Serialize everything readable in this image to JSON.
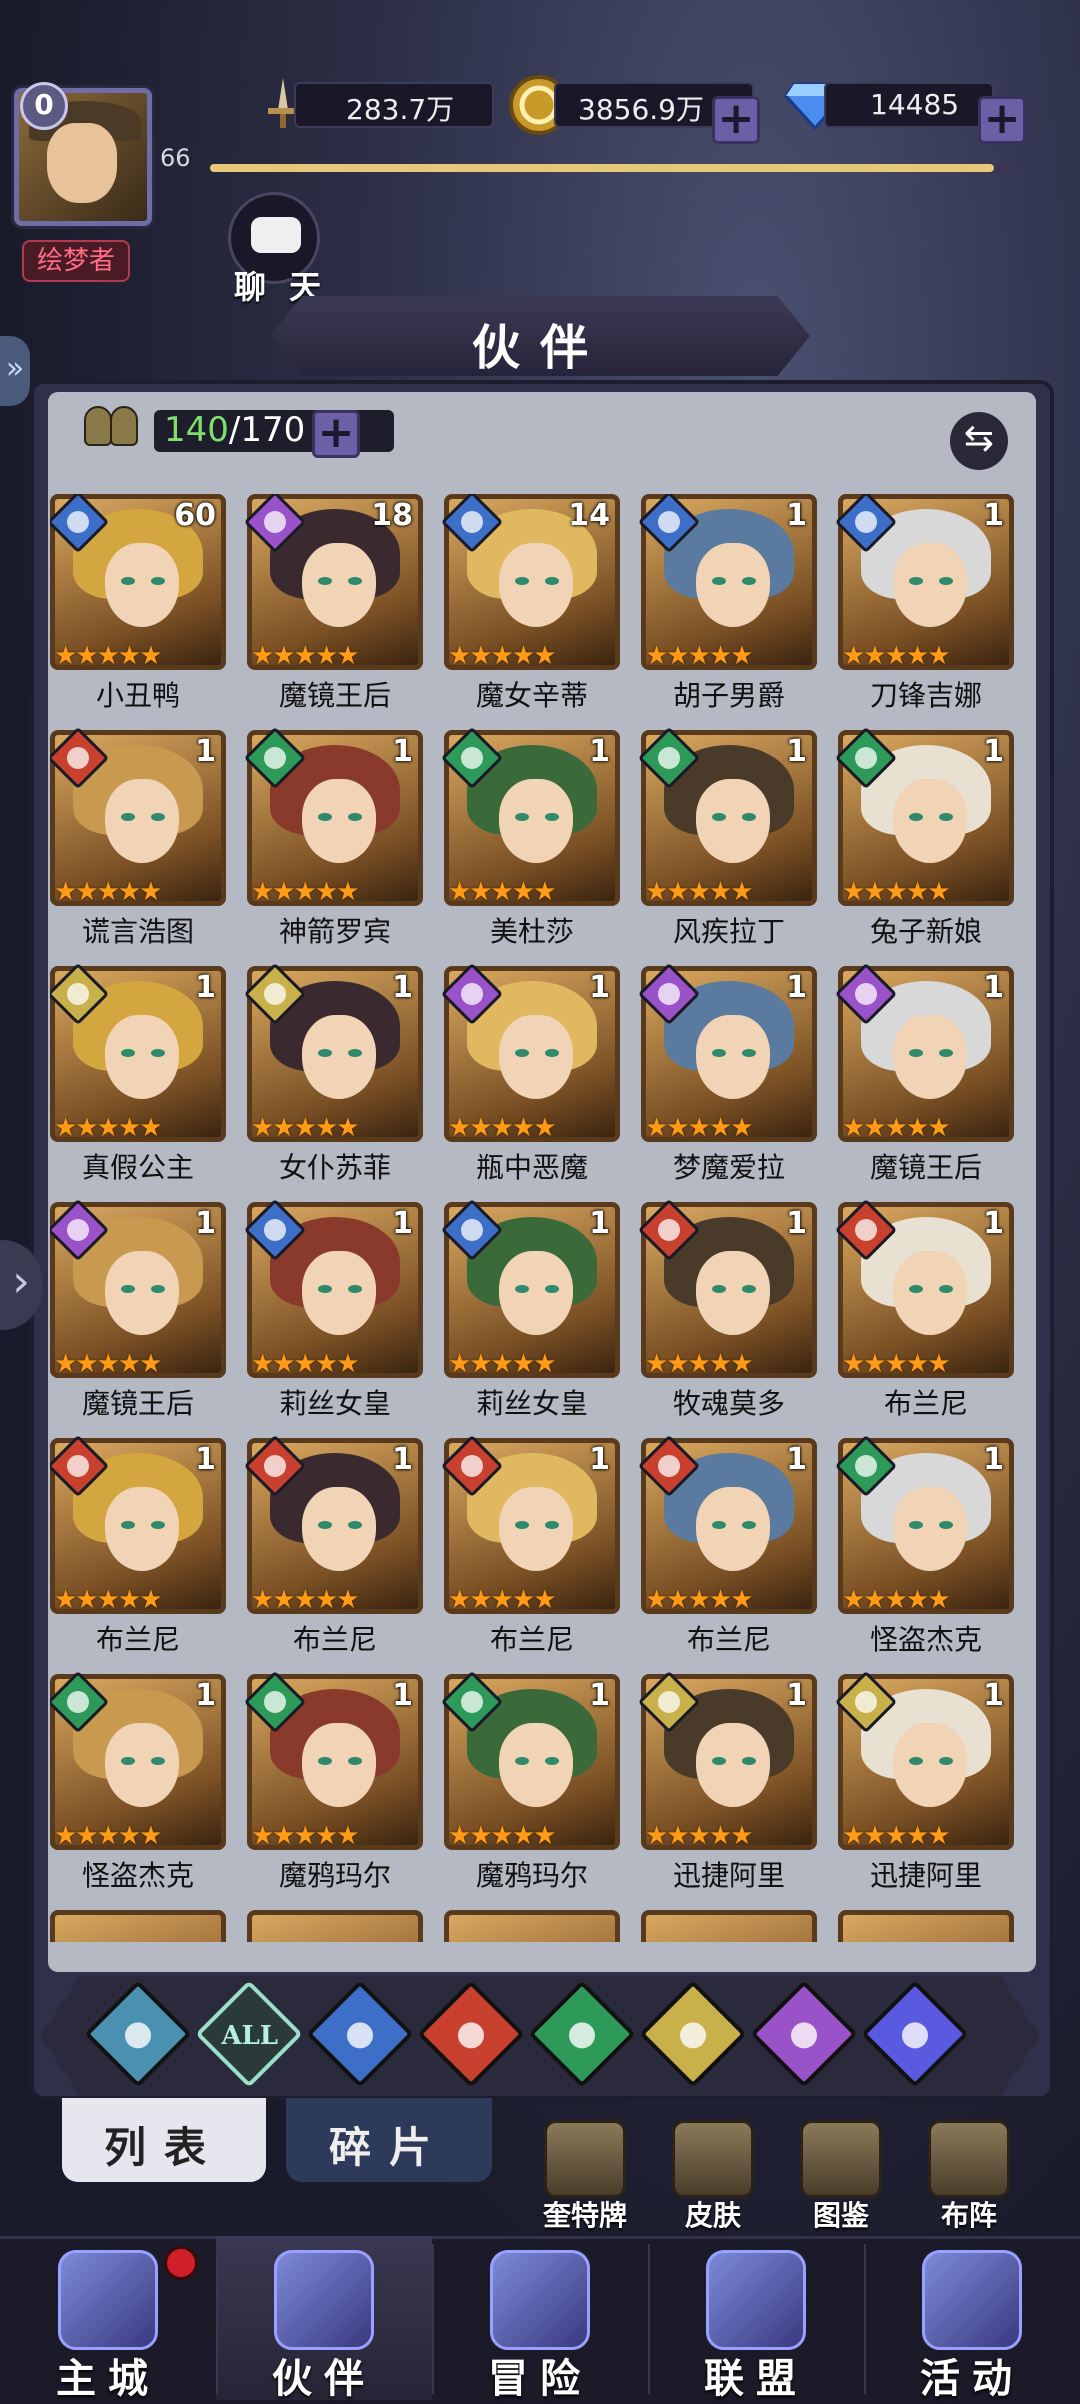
{
  "player": {
    "level_badge": "0",
    "level": "66",
    "title": "绘梦者",
    "xp_fraction": 0.98
  },
  "resources": {
    "power": {
      "icon": "sword-icon",
      "value": "283.7万"
    },
    "gold": {
      "icon": "gold-coin-icon",
      "value": "3856.9万",
      "add": "+"
    },
    "gems": {
      "icon": "diamond-icon",
      "value": "14485",
      "add": "+"
    }
  },
  "chat": {
    "label": "聊 天"
  },
  "header": {
    "title": "伙伴"
  },
  "capacity": {
    "current": "140",
    "max": "/170",
    "add": "+"
  },
  "swap_icon": "⇆",
  "companions": [
    {
      "name": "小丑鸭",
      "count": "60",
      "element": "water",
      "stars": "★★★★★"
    },
    {
      "name": "魔镜王后",
      "count": "18",
      "element": "dark",
      "stars": "★★★★★"
    },
    {
      "name": "魔女辛蒂",
      "count": "14",
      "element": "water",
      "stars": "★★★★★"
    },
    {
      "name": "胡子男爵",
      "count": "1",
      "element": "water",
      "stars": "★★★★★"
    },
    {
      "name": "刀锋吉娜",
      "count": "1",
      "element": "water",
      "stars": "★★★★★"
    },
    {
      "name": "谎言浩图",
      "count": "1",
      "element": "fire",
      "stars": "★★★★★"
    },
    {
      "name": "神箭罗宾",
      "count": "1",
      "element": "nature",
      "stars": "★★★★★"
    },
    {
      "name": "美杜莎",
      "count": "1",
      "element": "nature",
      "stars": "★★★★★"
    },
    {
      "name": "风疾拉丁",
      "count": "1",
      "element": "nature",
      "stars": "★★★★★"
    },
    {
      "name": "兔子新娘",
      "count": "1",
      "element": "nature",
      "stars": "★★★★★"
    },
    {
      "name": "真假公主",
      "count": "1",
      "element": "light",
      "stars": "★★★★★"
    },
    {
      "name": "女仆苏菲",
      "count": "1",
      "element": "light",
      "stars": "★★★★★"
    },
    {
      "name": "瓶中恶魔",
      "count": "1",
      "element": "dark",
      "stars": "★★★★★"
    },
    {
      "name": "梦魔爱拉",
      "count": "1",
      "element": "dark",
      "stars": "★★★★★"
    },
    {
      "name": "魔镜王后",
      "count": "1",
      "element": "dark",
      "stars": "★★★★★"
    },
    {
      "name": "魔镜王后",
      "count": "1",
      "element": "dark",
      "stars": "★★★★★"
    },
    {
      "name": "莉丝女皇",
      "count": "1",
      "element": "water",
      "stars": "★★★★★"
    },
    {
      "name": "莉丝女皇",
      "count": "1",
      "element": "water",
      "stars": "★★★★★"
    },
    {
      "name": "牧魂莫多",
      "count": "1",
      "element": "fire",
      "stars": "★★★★★"
    },
    {
      "name": "布兰尼",
      "count": "1",
      "element": "fire",
      "stars": "★★★★★"
    },
    {
      "name": "布兰尼",
      "count": "1",
      "element": "fire",
      "stars": "★★★★★"
    },
    {
      "name": "布兰尼",
      "count": "1",
      "element": "fire",
      "stars": "★★★★★"
    },
    {
      "name": "布兰尼",
      "count": "1",
      "element": "fire",
      "stars": "★★★★★"
    },
    {
      "name": "布兰尼",
      "count": "1",
      "element": "fire",
      "stars": "★★★★★"
    },
    {
      "name": "怪盗杰克",
      "count": "1",
      "element": "nature",
      "stars": "★★★★★"
    },
    {
      "name": "怪盗杰克",
      "count": "1",
      "element": "nature",
      "stars": "★★★★★"
    },
    {
      "name": "魔鸦玛尔",
      "count": "1",
      "element": "nature",
      "stars": "★★★★★"
    },
    {
      "name": "魔鸦玛尔",
      "count": "1",
      "element": "nature",
      "stars": "★★★★★"
    },
    {
      "name": "迅捷阿里",
      "count": "1",
      "element": "light",
      "stars": "★★★★★"
    },
    {
      "name": "迅捷阿里",
      "count": "1",
      "element": "light",
      "stars": "★★★★★"
    }
  ],
  "element_colors": {
    "water": "#3e6fc8",
    "dark": "#9a52c8",
    "fire": "#c8402e",
    "nature": "#2e9a5a",
    "light": "#c8b04a"
  },
  "filters": [
    {
      "id": "base",
      "icon": "chevron-up-icon"
    },
    {
      "id": "all",
      "label": "ALL"
    },
    {
      "id": "water",
      "icon": "water-drop-icon"
    },
    {
      "id": "fire",
      "icon": "flame-icon"
    },
    {
      "id": "nature",
      "icon": "swirl-icon"
    },
    {
      "id": "light",
      "icon": "sun-icon"
    },
    {
      "id": "dark",
      "icon": "moon-icon"
    },
    {
      "id": "cosmic",
      "icon": "planet-icon"
    }
  ],
  "tabs": {
    "list": "列表",
    "shards": "碎片"
  },
  "quick_actions": [
    {
      "label": "奎特牌",
      "icon": "card-wings-icon"
    },
    {
      "label": "皮肤",
      "icon": "outfit-icon"
    },
    {
      "label": "图鉴",
      "icon": "portrait-cards-icon"
    },
    {
      "label": "布阵",
      "icon": "formation-icon"
    }
  ],
  "nav": [
    {
      "label": "主城",
      "icon": "castle-icon"
    },
    {
      "label": "伙伴",
      "icon": "wizard-hat-icon"
    },
    {
      "label": "冒险",
      "icon": "compass-star-icon"
    },
    {
      "label": "联盟",
      "icon": "shield-crest-icon"
    },
    {
      "label": "活动",
      "icon": "cards-icon"
    }
  ]
}
